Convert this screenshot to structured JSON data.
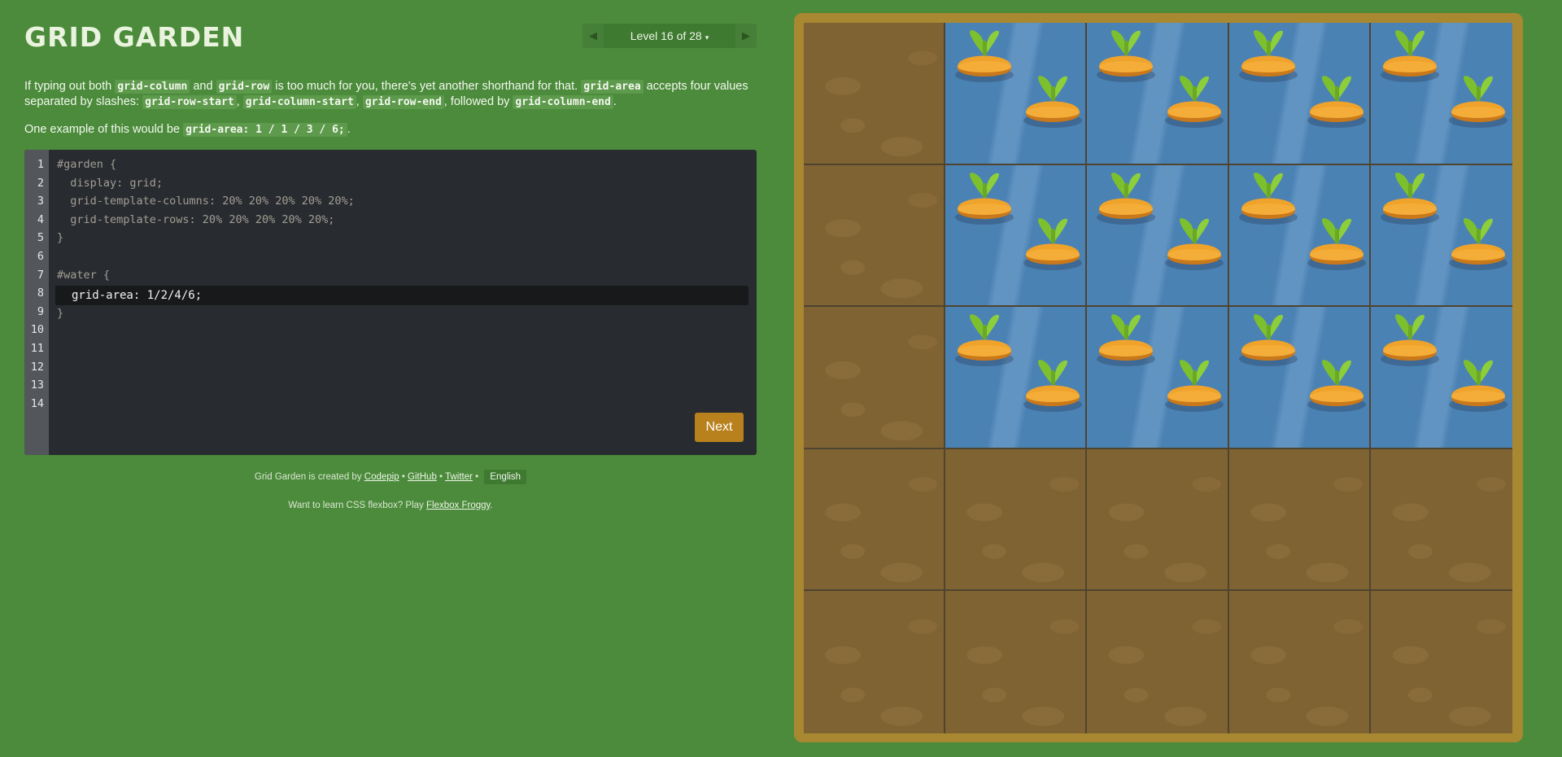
{
  "app": {
    "title": "GRID GARDEN"
  },
  "level": {
    "label": "Level 16 of 28",
    "caret": "▾",
    "prev": "◀",
    "next": "▶"
  },
  "instructions": {
    "p1": [
      {
        "t": "If typing out both "
      },
      {
        "c": "grid-column"
      },
      {
        "t": " and "
      },
      {
        "c": "grid-row"
      },
      {
        "t": " is too much for you, there's yet another shorthand for that. "
      },
      {
        "c": "grid-area"
      },
      {
        "t": " accepts four values separated by slashes: "
      },
      {
        "c": "grid-row-start"
      },
      {
        "t": ", "
      },
      {
        "c": "grid-column-start"
      },
      {
        "t": ", "
      },
      {
        "c": "grid-row-end"
      },
      {
        "t": ", followed by "
      },
      {
        "c": "grid-column-end"
      },
      {
        "t": "."
      }
    ],
    "p2": [
      {
        "t": "One example of this would be "
      },
      {
        "c": "grid-area: 1 / 1 / 3 / 6;"
      },
      {
        "t": "."
      }
    ]
  },
  "editor": {
    "line_numbers": [
      "1",
      "2",
      "3",
      "4",
      "5",
      "6",
      "7",
      "8",
      "9",
      "10",
      "11",
      "12",
      "13",
      "14"
    ],
    "lines": [
      "#garden {",
      "  display: grid;",
      "  grid-template-columns: 20% 20% 20% 20% 20%;",
      "  grid-template-rows: 20% 20% 20% 20% 20%;",
      "}",
      "",
      "#water {",
      "",
      "}"
    ],
    "input_value": "grid-area: 1/2/4/6;",
    "next_label": "Next"
  },
  "footer": {
    "credit_prefix": "Grid Garden is created by ",
    "codepip": "Codepip",
    "sep1": " • ",
    "github": "GitHub",
    "sep2": " • ",
    "twitter": "Twitter",
    "sep3": " • ",
    "language": "English",
    "promo_prefix": "Want to learn CSS flexbox? Play ",
    "promo_link": "Flexbox Froggy",
    "promo_suffix": "."
  },
  "garden": {
    "rows": [
      [
        "soil",
        "water",
        "water",
        "water",
        "water"
      ],
      [
        "soil",
        "water",
        "water",
        "water",
        "water"
      ],
      [
        "soil",
        "water",
        "water",
        "water",
        "water"
      ],
      [
        "soil",
        "soil",
        "soil",
        "soil",
        "soil"
      ],
      [
        "soil",
        "soil",
        "soil",
        "soil",
        "soil"
      ]
    ]
  },
  "colors": {
    "background": "#4b8b3b",
    "board": "#a88831",
    "soil": "#7f6333",
    "water": "#4b82b4",
    "carrot": "#f0a32a",
    "leaf": "#7cc02e",
    "next_button": "#b8811d"
  }
}
